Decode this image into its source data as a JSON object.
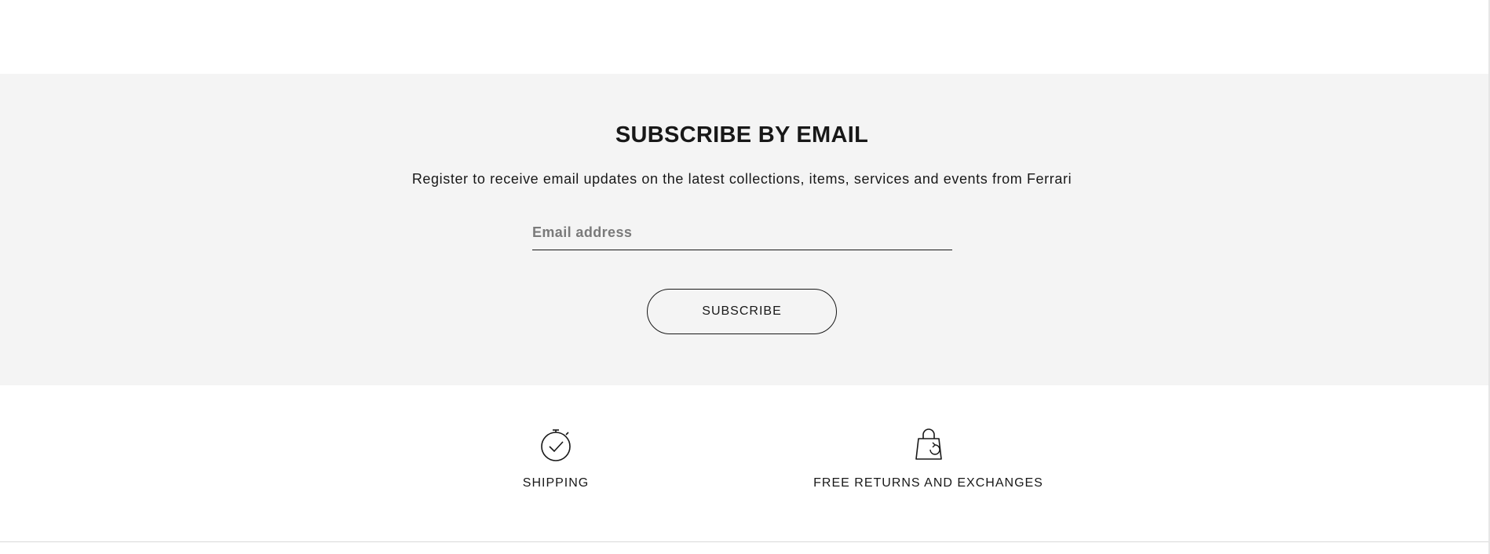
{
  "subscribe": {
    "title": "SUBSCRIBE BY EMAIL",
    "description": "Register to receive email updates on the latest collections, items, services and events from Ferrari",
    "email_placeholder": "Email address",
    "button_label": "SUBSCRIBE"
  },
  "services": [
    {
      "label": "SHIPPING",
      "icon": "stopwatch-check-icon"
    },
    {
      "label": "FREE RETURNS AND EXCHANGES",
      "icon": "shopping-bag-return-icon"
    }
  ],
  "colors": {
    "section_background": "#f4f4f4",
    "text": "#181818",
    "placeholder": "#7a7a7a"
  }
}
